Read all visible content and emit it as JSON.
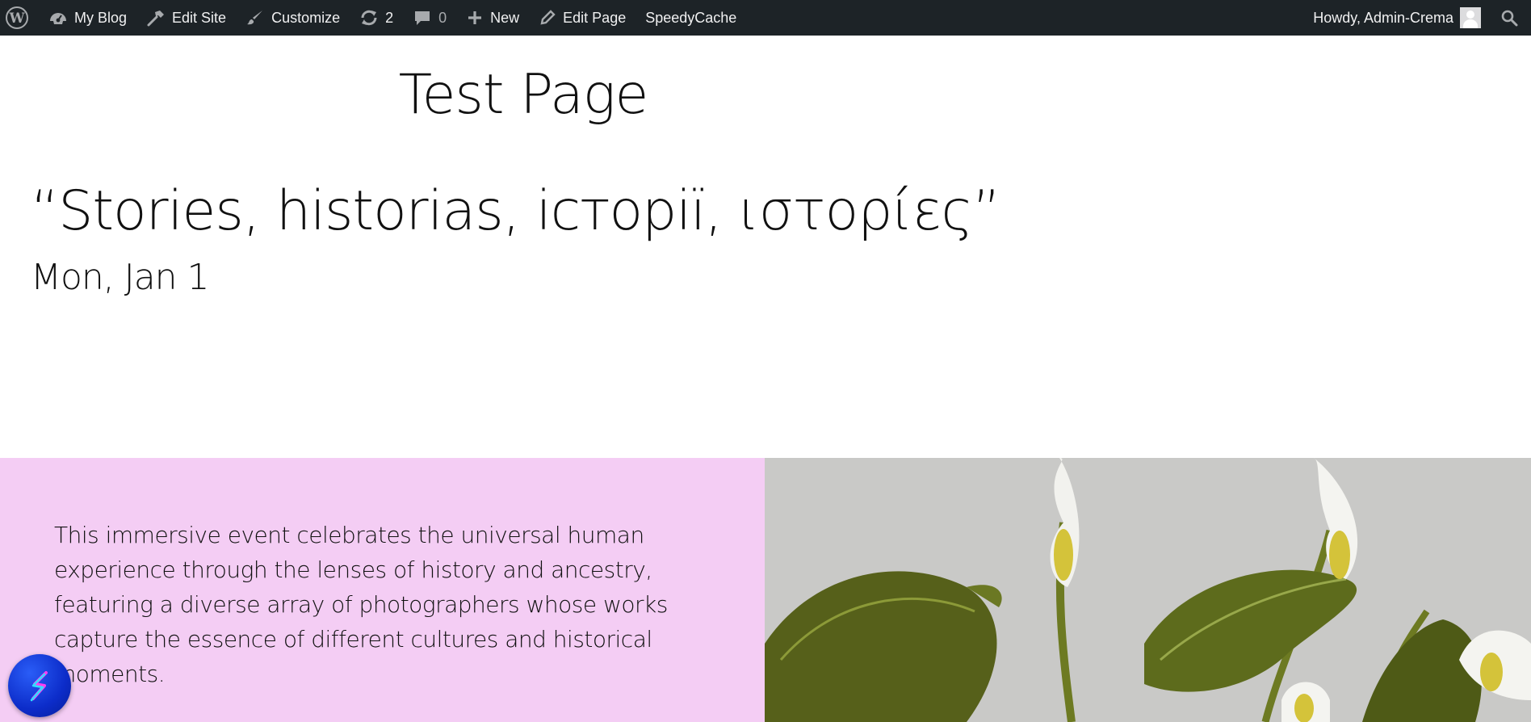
{
  "admin_bar": {
    "wp_logo_icon": "wordpress-logo-icon",
    "site_name": "My Blog",
    "edit_site": "Edit Site",
    "customize": "Customize",
    "updates_count": "2",
    "comments_count": "0",
    "new_label": "New",
    "edit_page": "Edit Page",
    "speedycache": "SpeedyCache",
    "howdy": "Howdy, Admin-Crema",
    "search_icon": "search-icon",
    "bg_color": "#1d2327"
  },
  "page": {
    "title": "Test Page",
    "headline": "“Stories, historias, історії, ιστορίες”",
    "date": "Mon, Jan 1",
    "description": "This immersive event celebrates the universal human experience through the lenses of history and ancestry, featuring a diverse array of photographers whose works capture the essence of different cultures and historical moments.",
    "panel_color": "#f4cdf4"
  }
}
